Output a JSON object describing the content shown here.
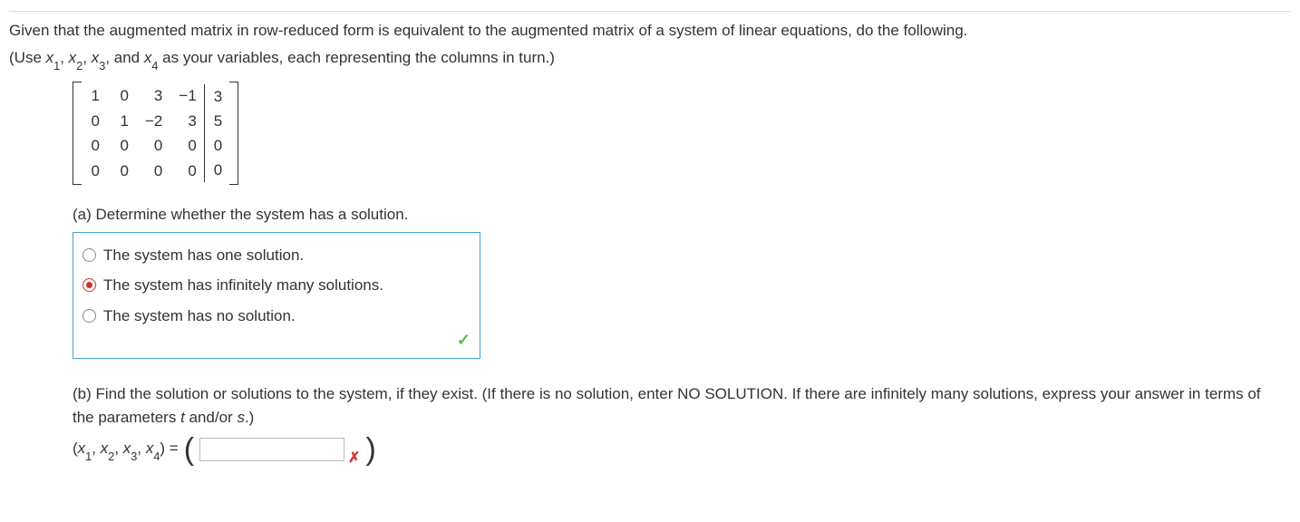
{
  "intro": {
    "line1": "Given that the augmented matrix in row-reduced form is equivalent to the augmented matrix of a system of linear equations, do the following.",
    "line2_pre": "(Use ",
    "var1": "x",
    "sub1": "1",
    "sep1": ", ",
    "var2": "x",
    "sub2": "2",
    "sep2": ", ",
    "var3": "x",
    "sub3": "3",
    "sep3": ", and ",
    "var4": "x",
    "sub4": "4",
    "line2_post": " as your variables, each representing the columns in turn.)"
  },
  "matrix": {
    "rows": [
      [
        "1",
        "0",
        "3",
        "−1"
      ],
      [
        "0",
        "1",
        "−2",
        "3"
      ],
      [
        "0",
        "0",
        "0",
        "0"
      ],
      [
        "0",
        "0",
        "0",
        "0"
      ]
    ],
    "aug": [
      "3",
      "5",
      "0",
      "0"
    ]
  },
  "partA": {
    "label": "(a) Determine whether the system has a solution.",
    "options": [
      {
        "text": "The system has one solution.",
        "selected": false
      },
      {
        "text": "The system has infinitely many solutions.",
        "selected": true
      },
      {
        "text": "The system has no solution.",
        "selected": false
      }
    ]
  },
  "partB": {
    "text_pre": "(b) Find the solution or solutions to the system, if they exist. (If there is no solution, enter NO SOLUTION. If there are infinitely many solutions, express your answer in terms of the parameters ",
    "param1": "t",
    "text_mid": " and/or ",
    "param2": "s",
    "text_post": ".)",
    "lhs_open": "(",
    "v1": "x",
    "s1": "1",
    "c1": ", ",
    "v2": "x",
    "s2": "2",
    "c2": ", ",
    "v3": "x",
    "s3": "3",
    "c3": ", ",
    "v4": "x",
    "s4": "4",
    "lhs_close": ") = ",
    "input_value": ""
  }
}
